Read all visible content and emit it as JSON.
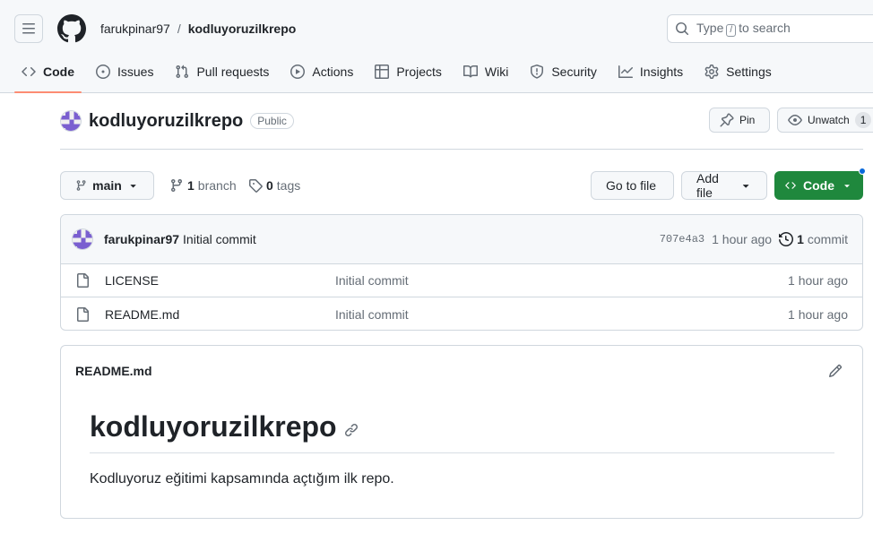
{
  "header": {
    "owner": "farukpinar97",
    "separator": "/",
    "repo": "kodluyoruzilkrepo",
    "search": {
      "pre": "Type",
      "key": "/",
      "post": "to search"
    }
  },
  "tabs": [
    {
      "label": "Code",
      "icon": "code-icon",
      "active": true
    },
    {
      "label": "Issues",
      "icon": "issue-icon"
    },
    {
      "label": "Pull requests",
      "icon": "pull-request-icon"
    },
    {
      "label": "Actions",
      "icon": "play-icon"
    },
    {
      "label": "Projects",
      "icon": "table-icon"
    },
    {
      "label": "Wiki",
      "icon": "book-icon"
    },
    {
      "label": "Security",
      "icon": "shield-icon"
    },
    {
      "label": "Insights",
      "icon": "graph-icon"
    },
    {
      "label": "Settings",
      "icon": "gear-icon"
    }
  ],
  "repo": {
    "name": "kodluyoruzilkrepo",
    "visibility": "Public",
    "pin_label": "Pin",
    "unwatch_label": "Unwatch",
    "watch_count": "1"
  },
  "toolbar": {
    "branch": "main",
    "branch_count": "1",
    "branch_word": "branch",
    "tag_count": "0",
    "tag_word": "tags",
    "go_to_file": "Go to file",
    "add_file": "Add file",
    "code": "Code"
  },
  "commit": {
    "author": "farukpinar97",
    "message": "Initial commit",
    "sha": "707e4a3",
    "age": "1 hour ago",
    "count": "1",
    "count_word": "commit"
  },
  "files": [
    {
      "name": "LICENSE",
      "message": "Initial commit",
      "age": "1 hour ago"
    },
    {
      "name": "README.md",
      "message": "Initial commit",
      "age": "1 hour ago"
    }
  ],
  "readme": {
    "filename": "README.md",
    "heading": "kodluyoruzilkrepo",
    "body": "Kodluyoruz eğitimi kapsamında açtığım ilk repo."
  },
  "colors": {
    "accent": "#1f883d",
    "tab_underline": "#fd8c73",
    "notification_dot": "#0969da"
  }
}
